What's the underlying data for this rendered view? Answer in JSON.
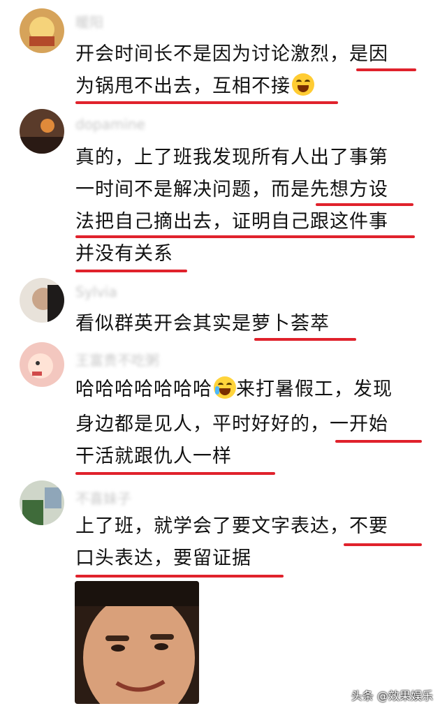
{
  "comments": [
    {
      "username": "暖阳",
      "lines": [
        "开会时间长不是因为讨论激烈，是因",
        "为锅甩不出去，互相不接"
      ],
      "emoji": "rolling-laughing-emoji"
    },
    {
      "username": "dopamine",
      "lines": [
        "真的，上了班我发现所有人出了事第",
        "一时间不是解决问题，而是先想方设",
        "法把自己摘出去，证明自己跟这件事",
        "并没有关系"
      ]
    },
    {
      "username": "Sylvia",
      "lines": [
        "看似群英开会其实是萝卜荟萃"
      ]
    },
    {
      "username": "王富贵不吃粥",
      "lines_a": "哈哈哈哈哈哈哈",
      "lines_a_tail": "来打暑假工，发现",
      "lines": [
        "身边都是见人，平时好好的，一开始",
        "干活就跟仇人一样"
      ],
      "emoji": "crying-laughing-emoji"
    },
    {
      "username": "不喜妹子",
      "lines": [
        "上了班，就学会了要文字表达，不要",
        "口头表达，要留证据"
      ]
    }
  ],
  "watermark": "头条 @效果娱乐",
  "colors": {
    "underline": "#e0222c",
    "text": "#111111"
  }
}
